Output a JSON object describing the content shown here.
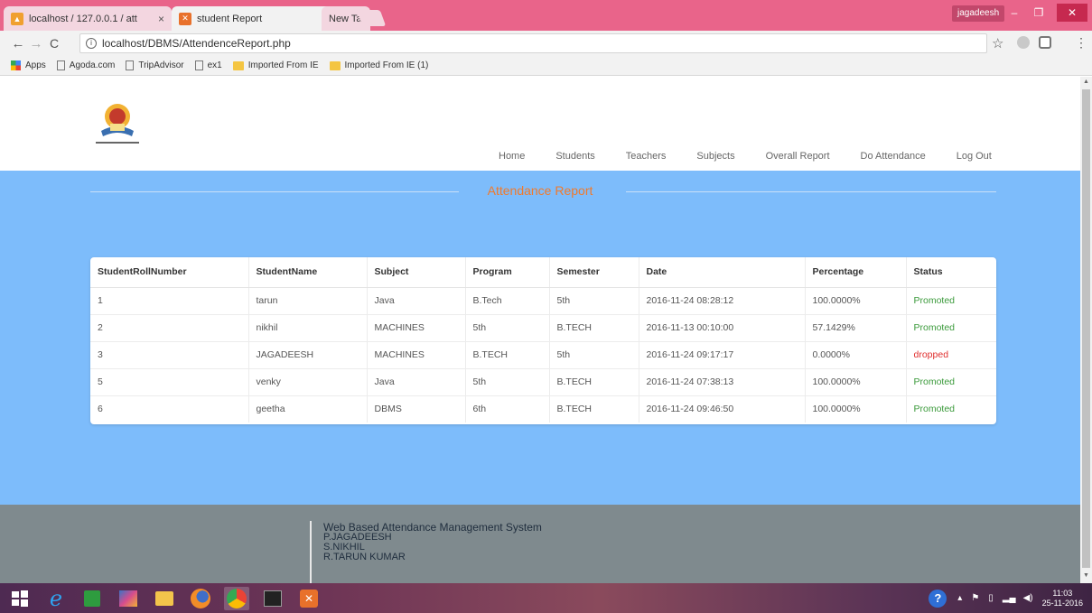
{
  "browser": {
    "tabs": [
      {
        "title": "localhost / 127.0.0.1 / att",
        "active": false
      },
      {
        "title": "student Report",
        "active": true
      },
      {
        "title": "New Tab",
        "active": false
      }
    ],
    "user": "jagadeesh",
    "url": "localhost/DBMS/AttendenceReport.php",
    "bookmarks": [
      {
        "label": "Apps",
        "icon": "apps-icon"
      },
      {
        "label": "Agoda.com",
        "icon": "page-icon"
      },
      {
        "label": "TripAdvisor",
        "icon": "page-icon"
      },
      {
        "label": "ex1",
        "icon": "page-icon"
      },
      {
        "label": "Imported From IE",
        "icon": "folder-icon"
      },
      {
        "label": "Imported From IE (1)",
        "icon": "folder-icon"
      }
    ]
  },
  "nav": {
    "items": [
      "Home",
      "Students",
      "Teachers",
      "Subjects",
      "Overall Report",
      "Do Attendance",
      "Log Out"
    ]
  },
  "report": {
    "title": "Attendance Report",
    "columns": [
      "StudentRollNumber",
      "StudentName",
      "Subject",
      "Program",
      "Semester",
      "Date",
      "Percentage",
      "Status"
    ],
    "rows": [
      {
        "roll": "1",
        "name": "tarun",
        "subject": "Java",
        "program": "B.Tech",
        "semester": "5th",
        "date": "2016-11-24 08:28:12",
        "percentage": "100.0000%",
        "status": "Promoted"
      },
      {
        "roll": "2",
        "name": "nikhil",
        "subject": "MACHINES",
        "program": "5th",
        "semester": "B.TECH",
        "date": "2016-11-13 00:10:00",
        "percentage": "57.1429%",
        "status": "Promoted"
      },
      {
        "roll": "3",
        "name": "JAGADEESH",
        "subject": "MACHINES",
        "program": "B.TECH",
        "semester": "5th",
        "date": "2016-11-24 09:17:17",
        "percentage": "0.0000%",
        "status": "dropped"
      },
      {
        "roll": "5",
        "name": "venky",
        "subject": "Java",
        "program": "5th",
        "semester": "B.TECH",
        "date": "2016-11-24 07:38:13",
        "percentage": "100.0000%",
        "status": "Promoted"
      },
      {
        "roll": "6",
        "name": "geetha",
        "subject": "DBMS",
        "program": "6th",
        "semester": "B.TECH",
        "date": "2016-11-24 09:46:50",
        "percentage": "100.0000%",
        "status": "Promoted"
      }
    ]
  },
  "footer": {
    "lines": [
      "Web Based Attendance Management System",
      "P.JAGADEESH",
      "S.NIKHIL",
      "R.TARUN KUMAR"
    ]
  },
  "taskbar": {
    "time": "11:03",
    "date": "25-11-2016"
  },
  "colors": {
    "chrome_frame": "#e9648a",
    "content_blue": "#7dbcfb",
    "title_orange": "#f07a2c",
    "promoted_green": "#3b9a3b",
    "dropped_red": "#e0302f",
    "footer_gray": "#7f8a8e"
  }
}
